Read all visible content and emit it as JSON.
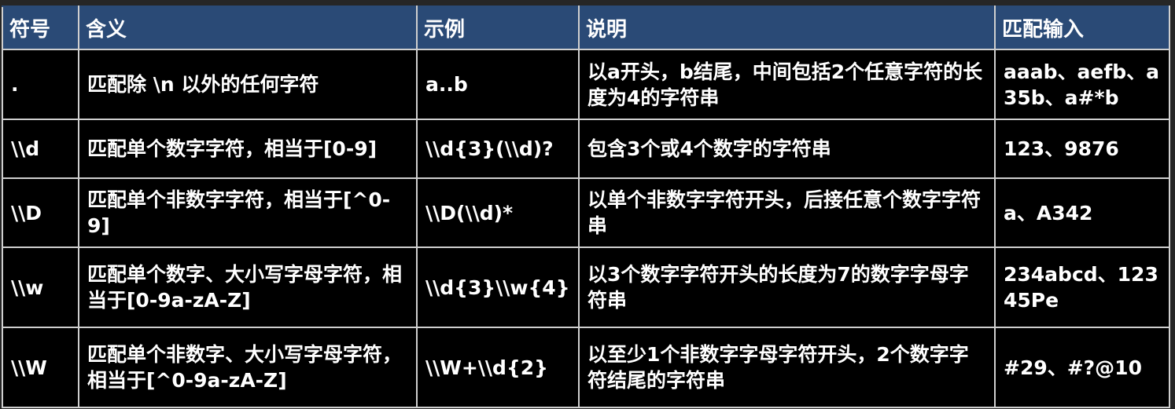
{
  "headers": {
    "symbol": "符号",
    "meaning": "含义",
    "example": "示例",
    "description": "说明",
    "match": "匹配输入"
  },
  "rows": [
    {
      "symbol": ".",
      "meaning": "匹配除 \\n 以外的任何字符",
      "example": "a..b",
      "description": "以a开头，b结尾，中间包括2个任意字符的长度为4的字符串",
      "match": "aaab、aefb、a35b、a#*b"
    },
    {
      "symbol": "\\\\d",
      "meaning": "匹配单个数字字符，相当于[0-9]",
      "example": "\\\\d{3}(\\\\d)?",
      "description": "包含3个或4个数字的字符串",
      "match": "123、9876"
    },
    {
      "symbol": "\\\\D",
      "meaning": "匹配单个非数字字符，相当于[^0-9]",
      "example": "\\\\D(\\\\d)*",
      "description": "以单个非数字字符开头，后接任意个数字字符串",
      "match": "a、A342"
    },
    {
      "symbol": "\\\\w",
      "meaning": "匹配单个数字、大小写字母字符，相当于[0-9a-zA-Z]",
      "example": "\\\\d{3}\\\\w{4}",
      "description": "以3个数字字符开头的长度为7的数字字母字符串",
      "match": "234abcd、12345Pe"
    },
    {
      "symbol": "\\\\W",
      "meaning": "匹配单个非数字、大小写字母字符，相当于[^0-9a-zA-Z]",
      "example": "\\\\W+\\\\d{2}",
      "description": "以至少1个非数字字母字符开头，2个数字字符结尾的字符串",
      "match": "#29、#?@10"
    }
  ],
  "colors": {
    "header_bg": "#2a4a76",
    "cell_bg": "#000000",
    "text": "#ffffff",
    "border": "#cfcfcf"
  }
}
